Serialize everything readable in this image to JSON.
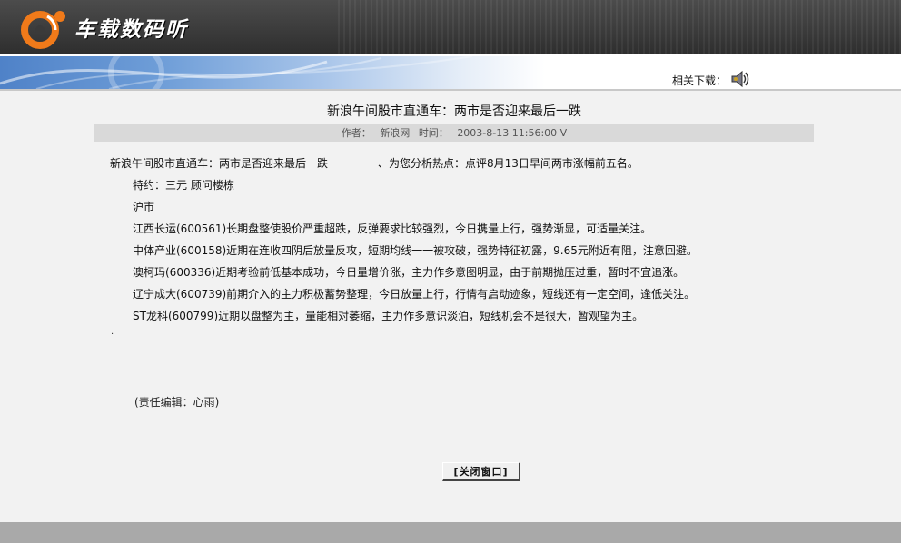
{
  "header": {
    "logo_text": "车载数码听",
    "download_label": "相关下载：",
    "logo_icon": "orange-swirl-logo",
    "speaker_icon": "speaker-icon"
  },
  "article": {
    "title": "新浪午间股市直通车：两市是否迎来最后一跌",
    "meta": {
      "author_label": "作者：",
      "author": "新浪网",
      "time_label": "时间：",
      "time": "2003-8-13 11:56:00 V"
    },
    "lead_left": "新浪午间股市直通车：两市是否迎来最后一跌",
    "lead_right": "一、为您分析热点：点评8月13日早间两市涨幅前五名。",
    "guest": "特约：三元 顾问楼栋",
    "market": "沪市",
    "items": [
      "江西长运(600561)长期盘整使股价严重超跌，反弹要求比较强烈，今日携量上行，强势渐显，可适量关注。",
      "中体产业(600158)近期在连收四阴后放量反攻，短期均线一一被攻破，强势特征初露，9.65元附近有阻，注意回避。",
      "澳柯玛(600336)近期考验前低基本成功，今日量增价涨，主力作多意图明显，由于前期抛压过重，暂时不宜追涨。",
      "辽宁成大(600739)前期介入的主力积极蓄势整理，今日放量上行，行情有启动迹象，短线还有一定空间，逢低关注。",
      "ST龙科(600799)近期以盘整为主，量能相对萎缩，主力作多意识淡泊，短线机会不是很大，暂观望为主。"
    ],
    "dot": ".",
    "editor": "(责任编辑：心雨)"
  },
  "controls": {
    "close_button": "[关闭窗口]"
  },
  "colors": {
    "logo_orange": "#f07a1a",
    "header_dark": "#3a3a3a",
    "banner_blue": "#5b8fd0",
    "meta_bar": "#d9d9d9",
    "footer": "#a9a9a9"
  }
}
